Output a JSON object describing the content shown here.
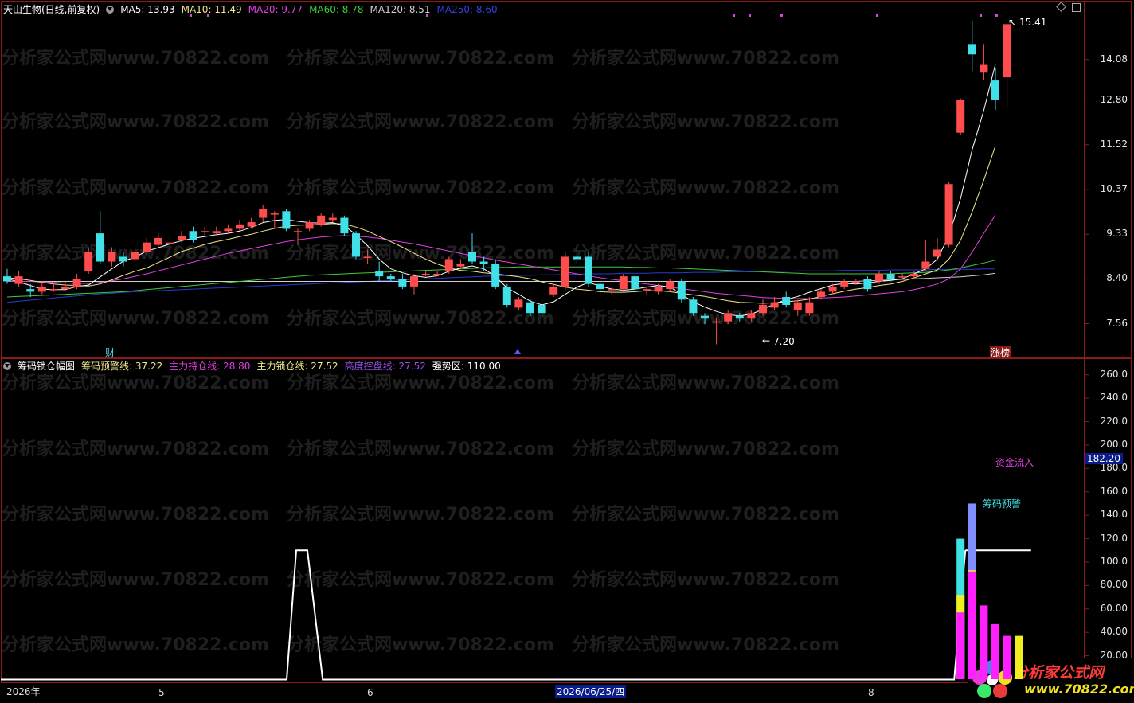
{
  "main_header": {
    "title": "天山生物(日线,前复权)",
    "ma5": "MA5: 13.93",
    "ma10": "MA10: 11.49",
    "ma20": "MA20: 9.77",
    "ma60": "MA60: 8.78",
    "ma120": "MA120: 8.51",
    "ma250": "MA250: 8.60"
  },
  "main_axis": [
    "14.08",
    "12.80",
    "11.52",
    "10.37",
    "9.33",
    "8.40",
    "7.56"
  ],
  "main_annotations": {
    "high": "15.41",
    "low": "7.20",
    "cai": "财",
    "zhangbang": "涨榜"
  },
  "sub_header": {
    "title": "筹码锁仓幅图",
    "l1": "筹码预警线: 37.22",
    "l2": "主力持仓线: 28.80",
    "l3": "主力锁仓线: 27.52",
    "l4": "高度控盘线: 27.52",
    "l5": "强势区: 110.00"
  },
  "sub_axis": [
    "260.0",
    "240.0",
    "220.0",
    "200.0",
    "180.0",
    "160.0",
    "140.0",
    "120.0",
    "100.0",
    "80.00",
    "60.00",
    "40.00",
    "20.00"
  ],
  "sub_current": "182.20",
  "sub_annotations": {
    "inflow": "资金流入",
    "warning": "筹码预警"
  },
  "date_axis": {
    "d1": "2026年",
    "d2": "5",
    "d3": "6",
    "d4": "2026/06/25/四",
    "d5": "8"
  },
  "watermark": "分析家公式网www.70822.com",
  "logo": {
    "name": "分析家公式网",
    "url": "www.70822.com"
  },
  "colors": {
    "up": "#ff4d4d",
    "down": "#3fe0e8",
    "ma5": "#ffffff",
    "ma10": "#f0e68c",
    "ma20": "#e040e0",
    "ma60": "#3dcc3d",
    "ma120": "#d0d0d0",
    "ma250": "#2a3ad0",
    "frame": "#8b1a1a"
  },
  "chart_data": [
    {
      "type": "candlestick",
      "title": "天山生物(日线,前复权)",
      "y_ticks": [
        14.08,
        12.8,
        11.52,
        10.37,
        9.33,
        8.4,
        7.56
      ],
      "ylim": [
        7.1,
        15.6
      ],
      "candles": [
        [
          8.45,
          8.35,
          8.6,
          8.3
        ],
        [
          8.3,
          8.45,
          8.55,
          8.25
        ],
        [
          8.2,
          8.15,
          8.3,
          8.05
        ],
        [
          8.15,
          8.25,
          8.35,
          8.1
        ],
        [
          8.2,
          8.2,
          8.3,
          8.15
        ],
        [
          8.2,
          8.25,
          8.35,
          8.15
        ],
        [
          8.25,
          8.4,
          8.5,
          8.2
        ],
        [
          8.55,
          8.95,
          9.05,
          8.5
        ],
        [
          9.35,
          8.75,
          9.85,
          8.7
        ],
        [
          8.75,
          8.95,
          9.05,
          8.65
        ],
        [
          8.85,
          8.75,
          8.95,
          8.65
        ],
        [
          8.8,
          8.95,
          9.05,
          8.75
        ],
        [
          8.95,
          9.15,
          9.25,
          8.9
        ],
        [
          9.1,
          9.25,
          9.35,
          9.05
        ],
        [
          9.15,
          9.15,
          9.3,
          9.1
        ],
        [
          9.2,
          9.3,
          9.4,
          9.15
        ],
        [
          9.4,
          9.2,
          9.5,
          9.15
        ],
        [
          9.4,
          9.4,
          9.5,
          9.3
        ],
        [
          9.35,
          9.4,
          9.5,
          9.3
        ],
        [
          9.4,
          9.45,
          9.55,
          9.35
        ],
        [
          9.45,
          9.55,
          9.65,
          9.4
        ],
        [
          9.5,
          9.6,
          9.7,
          9.45
        ],
        [
          9.7,
          9.9,
          10.0,
          9.6
        ],
        [
          9.8,
          9.8,
          9.85,
          9.45
        ],
        [
          9.85,
          9.45,
          9.9,
          9.4
        ],
        [
          9.4,
          9.4,
          9.45,
          9.1
        ],
        [
          9.45,
          9.6,
          9.65,
          9.4
        ],
        [
          9.55,
          9.75,
          9.8,
          9.5
        ],
        [
          9.65,
          9.7,
          9.8,
          9.6
        ],
        [
          9.7,
          9.35,
          9.75,
          9.3
        ],
        [
          9.35,
          8.85,
          9.4,
          8.8
        ],
        [
          8.85,
          8.85,
          9.0,
          8.7
        ],
        [
          8.55,
          8.45,
          8.75,
          8.35
        ],
        [
          8.45,
          8.4,
          8.5,
          8.35
        ],
        [
          8.4,
          8.25,
          8.5,
          8.2
        ],
        [
          8.25,
          8.45,
          8.5,
          8.1
        ],
        [
          8.5,
          8.5,
          8.55,
          8.45
        ],
        [
          8.5,
          8.5,
          8.55,
          8.45
        ],
        [
          8.55,
          8.8,
          8.85,
          8.5
        ],
        [
          8.65,
          8.7,
          8.8,
          8.6
        ],
        [
          8.95,
          8.75,
          9.35,
          8.7
        ],
        [
          8.75,
          8.7,
          8.85,
          8.55
        ],
        [
          8.7,
          8.25,
          8.8,
          8.2
        ],
        [
          8.25,
          7.9,
          8.3,
          7.85
        ],
        [
          7.85,
          8.0,
          8.05,
          7.8
        ],
        [
          7.95,
          7.75,
          8.0,
          7.7
        ],
        [
          7.9,
          7.75,
          8.0,
          7.65
        ],
        [
          8.1,
          8.25,
          8.3,
          8.05
        ],
        [
          8.25,
          8.85,
          8.95,
          8.15
        ],
        [
          8.85,
          8.8,
          9.05,
          8.7
        ],
        [
          8.85,
          8.3,
          8.95,
          8.25
        ],
        [
          8.3,
          8.2,
          8.35,
          8.1
        ],
        [
          8.2,
          8.2,
          8.25,
          8.1
        ],
        [
          8.2,
          8.45,
          8.5,
          8.15
        ],
        [
          8.45,
          8.2,
          8.5,
          8.1
        ],
        [
          8.2,
          8.2,
          8.25,
          8.1
        ],
        [
          8.15,
          8.25,
          8.3,
          8.1
        ],
        [
          8.2,
          8.35,
          8.4,
          8.15
        ],
        [
          8.35,
          8.0,
          8.4,
          7.95
        ],
        [
          8.0,
          7.75,
          8.05,
          7.7
        ],
        [
          7.7,
          7.65,
          7.75,
          7.55
        ],
        [
          7.6,
          7.6,
          7.65,
          7.2
        ],
        [
          7.6,
          7.75,
          7.8,
          7.55
        ],
        [
          7.7,
          7.65,
          7.75,
          7.6
        ],
        [
          7.65,
          7.75,
          7.8,
          7.6
        ],
        [
          7.75,
          7.9,
          8.0,
          7.7
        ],
        [
          7.85,
          7.95,
          8.05,
          7.8
        ],
        [
          8.05,
          7.9,
          8.15,
          7.85
        ],
        [
          7.8,
          7.95,
          8.0,
          7.7
        ],
        [
          7.75,
          7.95,
          8.05,
          7.7
        ],
        [
          8.05,
          8.15,
          8.2,
          8.0
        ],
        [
          8.15,
          8.25,
          8.3,
          8.1
        ],
        [
          8.25,
          8.35,
          8.4,
          8.2
        ],
        [
          8.35,
          8.35,
          8.4,
          8.3
        ],
        [
          8.4,
          8.2,
          8.45,
          8.15
        ],
        [
          8.35,
          8.5,
          8.55,
          8.3
        ],
        [
          8.5,
          8.4,
          8.55,
          8.35
        ],
        [
          8.45,
          8.45,
          8.5,
          8.4
        ],
        [
          8.45,
          8.5,
          8.55,
          8.4
        ],
        [
          8.6,
          8.75,
          9.2,
          8.55
        ],
        [
          8.85,
          9.0,
          9.25,
          8.8
        ],
        [
          9.1,
          10.5,
          10.55,
          9.05
        ],
        [
          11.85,
          12.8,
          12.85,
          11.8
        ],
        [
          14.6,
          14.25,
          15.41,
          13.7
        ],
        [
          13.65,
          13.9,
          14.6,
          13.4
        ],
        [
          13.4,
          12.8,
          13.8,
          12.5
        ],
        [
          13.5,
          15.3,
          15.35,
          12.6
        ]
      ],
      "ma5": [
        8.4,
        8.34,
        8.27,
        8.2,
        8.19,
        8.19,
        8.25,
        8.28,
        8.44,
        8.6,
        8.76,
        8.84,
        8.97,
        9.04,
        9.12,
        9.19,
        9.24,
        9.28,
        9.32,
        9.35,
        9.4,
        9.48,
        9.59,
        9.64,
        9.66,
        9.62,
        9.59,
        9.58,
        9.59,
        9.52,
        9.32,
        9.08,
        8.8,
        8.6,
        8.52,
        8.46,
        8.43,
        8.46,
        8.55,
        8.62,
        8.66,
        8.6,
        8.45,
        8.22,
        8.1,
        7.97,
        7.9,
        7.96,
        8.1,
        8.24,
        8.33,
        8.26,
        8.2,
        8.18,
        8.2,
        8.24,
        8.27,
        8.24,
        8.1,
        7.96,
        7.86,
        7.78,
        7.72,
        7.7,
        7.73,
        7.82,
        7.92,
        8.0,
        8.06,
        8.14,
        8.21,
        8.28,
        8.31,
        8.3,
        8.32,
        8.35,
        8.37,
        8.4,
        8.5,
        8.6,
        8.8,
        9.3,
        10.15,
        11.39,
        12.49,
        13.93
      ],
      "ma10": [
        8.42,
        8.4,
        8.37,
        8.33,
        8.3,
        8.28,
        8.27,
        8.26,
        8.3,
        8.38,
        8.47,
        8.55,
        8.62,
        8.73,
        8.84,
        8.96,
        9.03,
        9.11,
        9.17,
        9.22,
        9.28,
        9.33,
        9.4,
        9.46,
        9.51,
        9.53,
        9.54,
        9.55,
        9.57,
        9.56,
        9.49,
        9.4,
        9.28,
        9.17,
        9.05,
        8.92,
        8.8,
        8.7,
        8.62,
        8.57,
        8.55,
        8.52,
        8.5,
        8.47,
        8.44,
        8.4,
        8.34,
        8.29,
        8.24,
        8.2,
        8.18,
        8.15,
        8.14,
        8.14,
        8.15,
        8.17,
        8.17,
        8.15,
        8.12,
        8.09,
        8.06,
        8.02,
        7.98,
        7.95,
        7.94,
        7.93,
        7.94,
        7.96,
        7.98,
        8.01,
        8.06,
        8.11,
        8.16,
        8.2,
        8.23,
        8.27,
        8.3,
        8.35,
        8.42,
        8.5,
        8.58,
        8.8,
        9.2,
        9.84,
        10.6,
        11.49
      ],
      "ma20": [
        8.35,
        8.35,
        8.35,
        8.34,
        8.33,
        8.32,
        8.31,
        8.31,
        8.33,
        8.36,
        8.4,
        8.45,
        8.5,
        8.56,
        8.62,
        8.68,
        8.74,
        8.8,
        8.86,
        8.92,
        8.97,
        9.02,
        9.07,
        9.12,
        9.17,
        9.21,
        9.24,
        9.27,
        9.29,
        9.3,
        9.29,
        9.27,
        9.24,
        9.2,
        9.16,
        9.12,
        9.07,
        9.02,
        8.97,
        8.92,
        8.87,
        8.83,
        8.78,
        8.74,
        8.7,
        8.66,
        8.62,
        8.58,
        8.54,
        8.5,
        8.46,
        8.42,
        8.39,
        8.36,
        8.33,
        8.3,
        8.27,
        8.24,
        8.21,
        8.18,
        8.15,
        8.12,
        8.1,
        8.08,
        8.06,
        8.04,
        8.03,
        8.02,
        8.02,
        8.02,
        8.03,
        8.04,
        8.05,
        8.07,
        8.09,
        8.11,
        8.13,
        8.15,
        8.19,
        8.24,
        8.3,
        8.4,
        8.6,
        8.95,
        9.35,
        9.77
      ],
      "ma60": [
        8.05,
        8.06,
        8.07,
        8.08,
        8.09,
        8.1,
        8.11,
        8.12,
        8.13,
        8.14,
        8.15,
        8.17,
        8.19,
        8.21,
        8.23,
        8.25,
        8.27,
        8.29,
        8.31,
        8.33,
        8.35,
        8.37,
        8.39,
        8.41,
        8.43,
        8.45,
        8.47,
        8.48,
        8.49,
        8.5,
        8.51,
        8.52,
        8.53,
        8.54,
        8.55,
        8.56,
        8.57,
        8.58,
        8.59,
        8.6,
        8.61,
        8.62,
        8.63,
        8.63,
        8.64,
        8.64,
        8.64,
        8.64,
        8.64,
        8.64,
        8.64,
        8.64,
        8.64,
        8.64,
        8.63,
        8.63,
        8.62,
        8.62,
        8.61,
        8.6,
        8.59,
        8.58,
        8.57,
        8.56,
        8.55,
        8.54,
        8.53,
        8.52,
        8.51,
        8.5,
        8.5,
        8.5,
        8.5,
        8.5,
        8.5,
        8.5,
        8.5,
        8.51,
        8.52,
        8.53,
        8.55,
        8.58,
        8.62,
        8.67,
        8.72,
        8.78
      ],
      "ma120": [
        8.35,
        8.35,
        8.35,
        8.35,
        8.35,
        8.35,
        8.35,
        8.35,
        8.35,
        8.35,
        8.35,
        8.35,
        8.35,
        8.35,
        8.35,
        8.35,
        8.35,
        8.35,
        8.35,
        8.35,
        8.35,
        8.35,
        8.35,
        8.35,
        8.35,
        8.35,
        8.35,
        8.35,
        8.35,
        8.35,
        8.35,
        8.35,
        8.35,
        8.35,
        8.35,
        8.35,
        8.35,
        8.35,
        8.35,
        8.35,
        8.35,
        8.35,
        8.35,
        8.35,
        8.35,
        8.35,
        8.35,
        8.35,
        8.35,
        8.35,
        8.35,
        8.35,
        8.35,
        8.35,
        8.35,
        8.35,
        8.35,
        8.35,
        8.35,
        8.35,
        8.35,
        8.35,
        8.35,
        8.35,
        8.35,
        8.35,
        8.35,
        8.35,
        8.35,
        8.35,
        8.35,
        8.35,
        8.35,
        8.35,
        8.36,
        8.37,
        8.38,
        8.39,
        8.4,
        8.41,
        8.42,
        8.43,
        8.44,
        8.46,
        8.48,
        8.51
      ],
      "ma250": [
        7.95,
        7.97,
        7.99,
        8.01,
        8.03,
        8.05,
        8.07,
        8.09,
        8.11,
        8.12,
        8.14,
        8.15,
        8.16,
        8.17,
        8.18,
        8.19,
        8.2,
        8.21,
        8.22,
        8.23,
        8.24,
        8.25,
        8.26,
        8.27,
        8.28,
        8.29,
        8.3,
        8.31,
        8.32,
        8.33,
        8.34,
        8.35,
        8.36,
        8.37,
        8.38,
        8.39,
        8.4,
        8.41,
        8.42,
        8.43,
        8.44,
        8.45,
        8.46,
        8.46,
        8.47,
        8.47,
        8.48,
        8.48,
        8.49,
        8.49,
        8.5,
        8.5,
        8.5,
        8.51,
        8.51,
        8.51,
        8.52,
        8.52,
        8.52,
        8.53,
        8.53,
        8.53,
        8.54,
        8.54,
        8.54,
        8.55,
        8.55,
        8.55,
        8.56,
        8.56,
        8.56,
        8.56,
        8.57,
        8.57,
        8.57,
        8.57,
        8.58,
        8.58,
        8.58,
        8.58,
        8.59,
        8.59,
        8.59,
        8.59,
        8.6,
        8.6
      ]
    },
    {
      "type": "bar",
      "title": "筹码锁仓幅图",
      "y_ticks": [
        260,
        240,
        220,
        200,
        180,
        160,
        140,
        120,
        100,
        80,
        60,
        40,
        20
      ],
      "ylim": [
        0,
        270
      ],
      "step_line": {
        "low": 0,
        "high": 110,
        "rise_index": 25,
        "fall_index": 27
      },
      "strong_zone": 110,
      "bars": [
        {
          "index": 82,
          "magenta": 57,
          "yellow": 72,
          "cyan": 120
        },
        {
          "index": 83,
          "magenta": 92,
          "yellow": 93,
          "blue": 150
        },
        {
          "index": 84,
          "magenta": 63
        },
        {
          "index": 85,
          "magenta": 47
        },
        {
          "index": 86,
          "magenta": 37
        },
        {
          "index": 87,
          "yellow": 37
        }
      ]
    }
  ]
}
